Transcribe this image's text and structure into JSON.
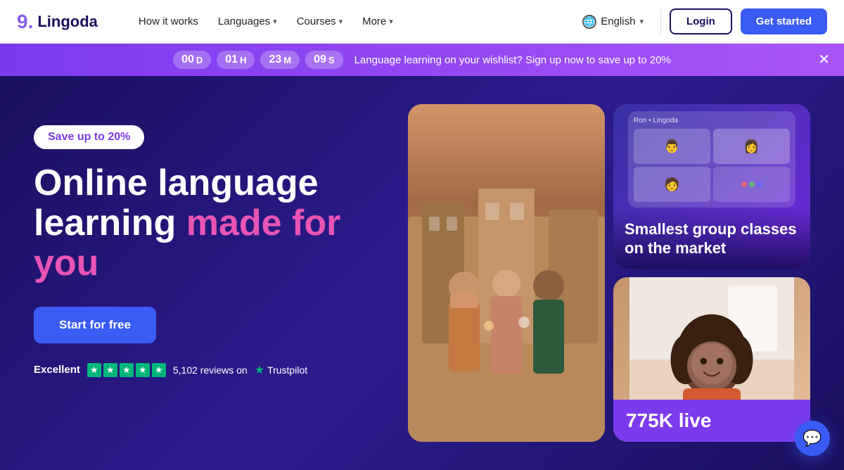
{
  "brand": {
    "name": "Lingoda",
    "logo_symbol": "9."
  },
  "navbar": {
    "how_it_works": "How it works",
    "languages": "Languages",
    "courses": "Courses",
    "more": "More",
    "language": "English",
    "login": "Login",
    "get_started": "Get started"
  },
  "promo_banner": {
    "countdown": {
      "days_val": "00",
      "days_unit": "D",
      "hours_val": "01",
      "hours_unit": "H",
      "minutes_val": "23",
      "minutes_unit": "M",
      "seconds_val": "09",
      "seconds_unit": "S"
    },
    "text": "Language learning on your wishlist? Sign up now to save up to 20%"
  },
  "hero": {
    "save_badge": "Save up to 20%",
    "title_line1": "Online language",
    "title_line2": "learning ",
    "title_accent": "made for",
    "title_line3": "you",
    "cta_button": "Start for free",
    "trustpilot": {
      "label": "Excellent",
      "review_text": "5,102 reviews on",
      "platform": "Trustpilot"
    },
    "top_right_card": {
      "title": "Smallest group classes on the market"
    },
    "video_call_header": "Ron • Lingoda",
    "bottom_right_stat": "775K live"
  }
}
